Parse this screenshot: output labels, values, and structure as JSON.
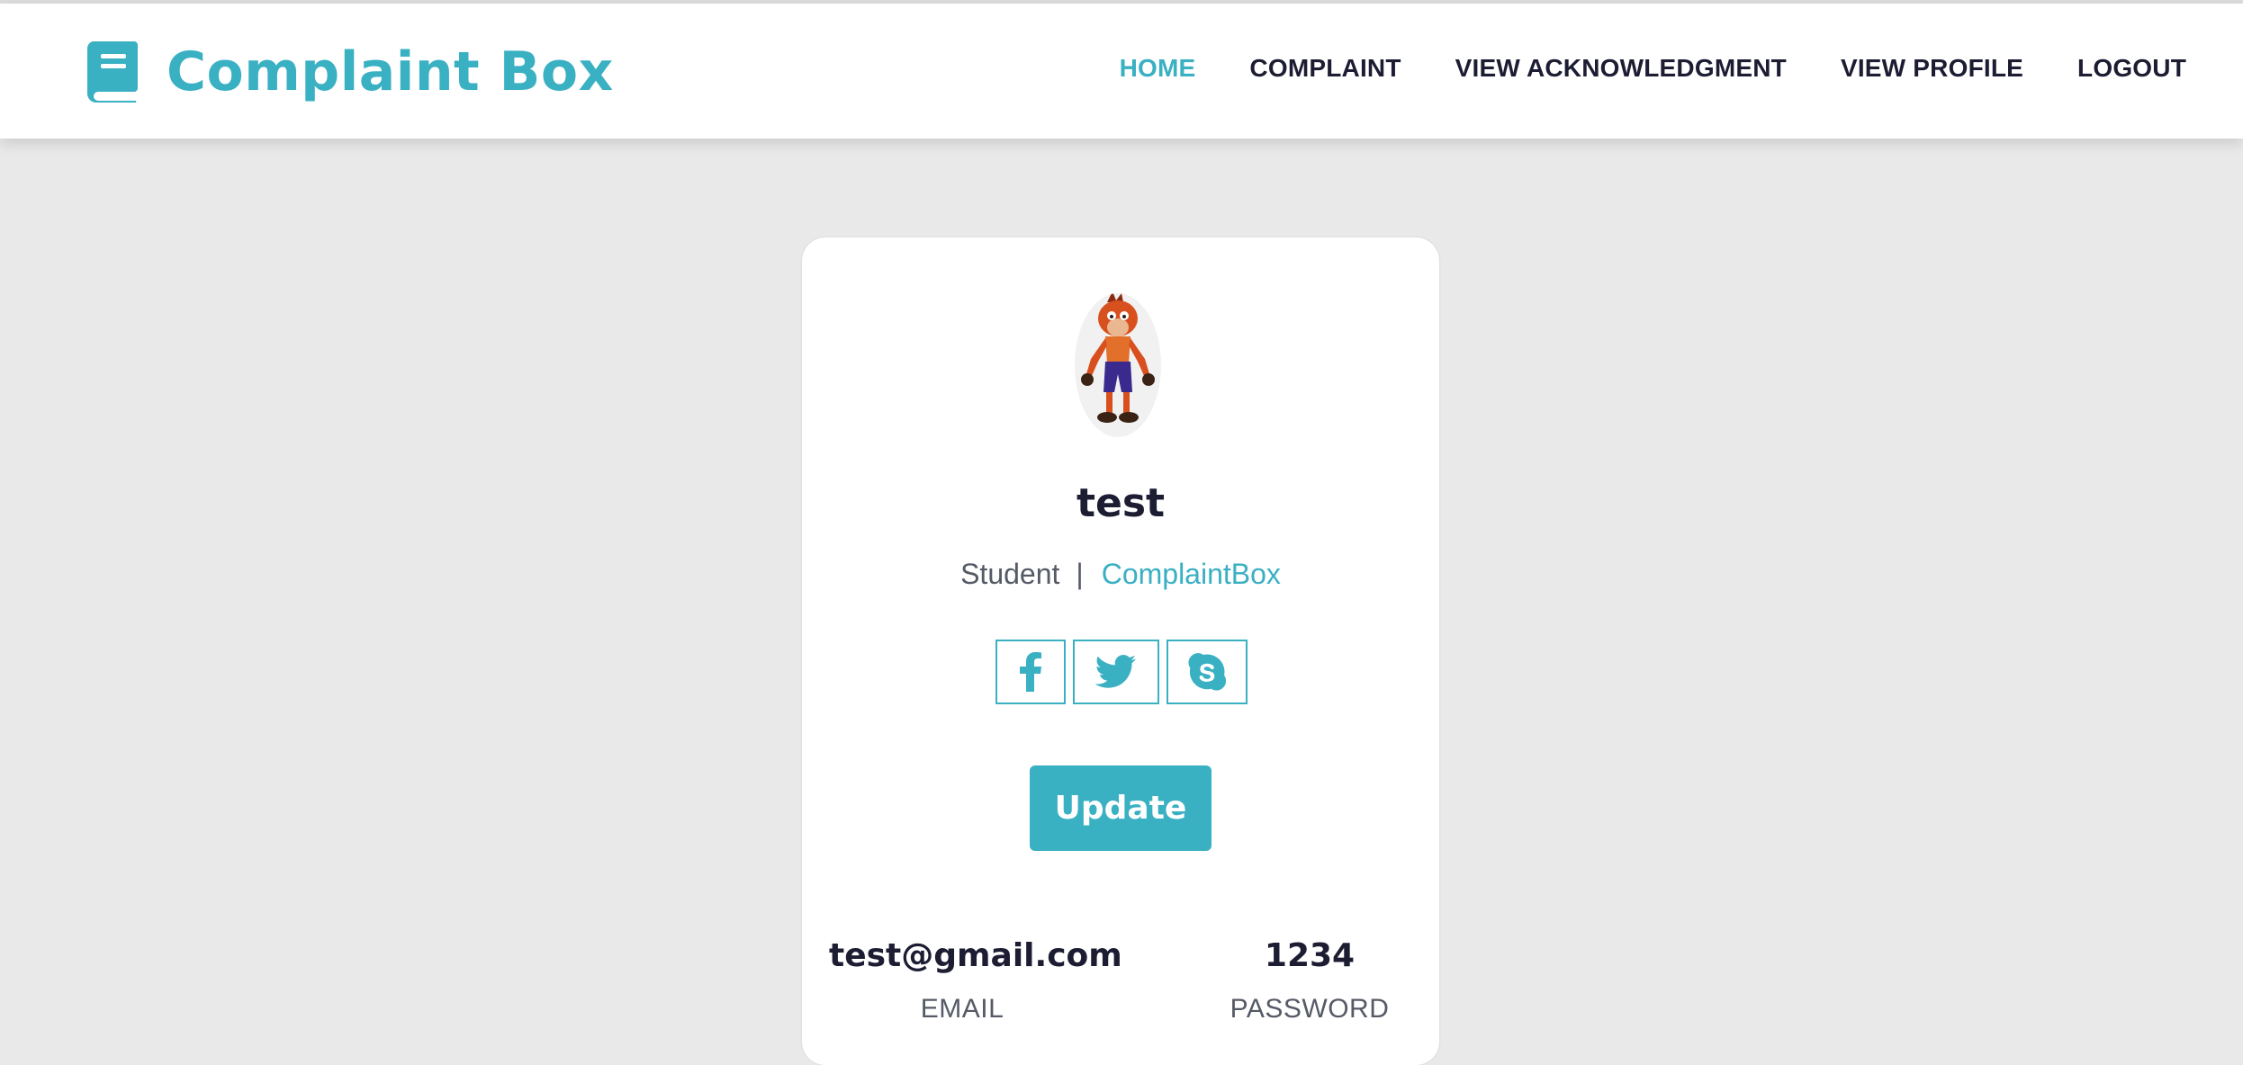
{
  "brand": {
    "title": "Complaint Box",
    "icon": "book-icon",
    "color": "#3ab0c3"
  },
  "nav": {
    "items": [
      {
        "label": "HOME",
        "active": true
      },
      {
        "label": "COMPLAINT",
        "active": false
      },
      {
        "label": "VIEW ACKNOWLEDGMENT",
        "active": false
      },
      {
        "label": "VIEW PROFILE",
        "active": false
      },
      {
        "label": "LOGOUT",
        "active": false
      }
    ]
  },
  "profile": {
    "avatar": "avatar-image",
    "name": "test",
    "role": "Student",
    "separator": "|",
    "organization": "ComplaintBox",
    "socials": [
      {
        "icon": "facebook-icon"
      },
      {
        "icon": "twitter-icon"
      },
      {
        "icon": "skype-icon"
      }
    ],
    "update_label": "Update",
    "email_value": "test@gmail.com",
    "email_label": "EMAIL",
    "password_value": "1234",
    "password_label": "PASSWORD"
  },
  "colors": {
    "accent": "#3ab0c3",
    "text_dark": "#1c1c33",
    "text_muted": "#555a66",
    "background": "#e9e9e9"
  }
}
